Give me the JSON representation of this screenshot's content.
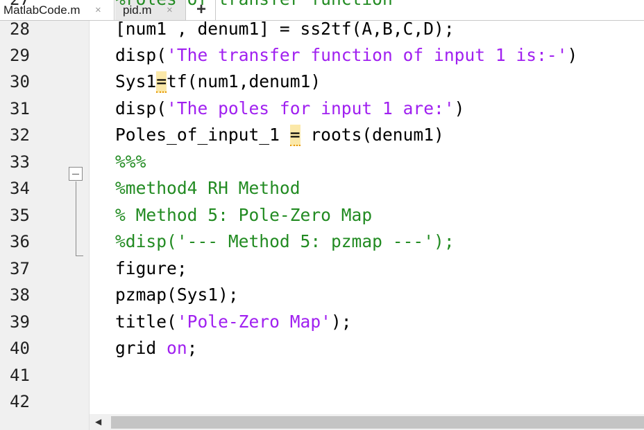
{
  "tabs": [
    {
      "label": "MatlabCode.m",
      "close": "×"
    },
    {
      "label": "pid.m",
      "close": "×"
    }
  ],
  "add_tab_label": "+",
  "partial_top_line": "%roles of transfer function",
  "lines": [
    {
      "num": "28"
    },
    {
      "num": "29"
    },
    {
      "num": "30"
    },
    {
      "num": "31"
    },
    {
      "num": "32"
    },
    {
      "num": "33"
    },
    {
      "num": "34"
    },
    {
      "num": "35"
    },
    {
      "num": "36"
    },
    {
      "num": "37"
    },
    {
      "num": "38"
    },
    {
      "num": "39"
    },
    {
      "num": "40"
    },
    {
      "num": "41"
    },
    {
      "num": "42"
    }
  ],
  "code": {
    "l28": "[num1 , denum1] = ss2tf(A,B,C,D);",
    "l29_a": "disp(",
    "l29_s": "'The transfer function of input 1 is:-'",
    "l29_b": ")",
    "l30_a": "Sys1",
    "l30_w": "=",
    "l30_b": "tf(num1,denum1)",
    "l31_a": "disp(",
    "l31_s": "'The poles for input 1 are:'",
    "l31_b": ")",
    "l32_a": "Poles_of_input_1 ",
    "l32_w": "=",
    "l32_b": " roots(denum1)",
    "l33": "%%%",
    "l34": "%method4 RH Method",
    "l35": "% Method 5: Pole-Zero Map",
    "l36": "%disp('--- Method 5: pzmap ---');",
    "l37": "figure;",
    "l38": "pzmap(Sys1);",
    "l39_a": "title(",
    "l39_s": "'Pole-Zero Map'",
    "l39_b": ");",
    "l40_a": "grid ",
    "l40_s": "on",
    "l40_b": ";"
  },
  "scroll_left_arrow": "◀",
  "colors": {
    "string": "#a020f0",
    "comment": "#228b22",
    "warning": "#fbe8a8"
  }
}
